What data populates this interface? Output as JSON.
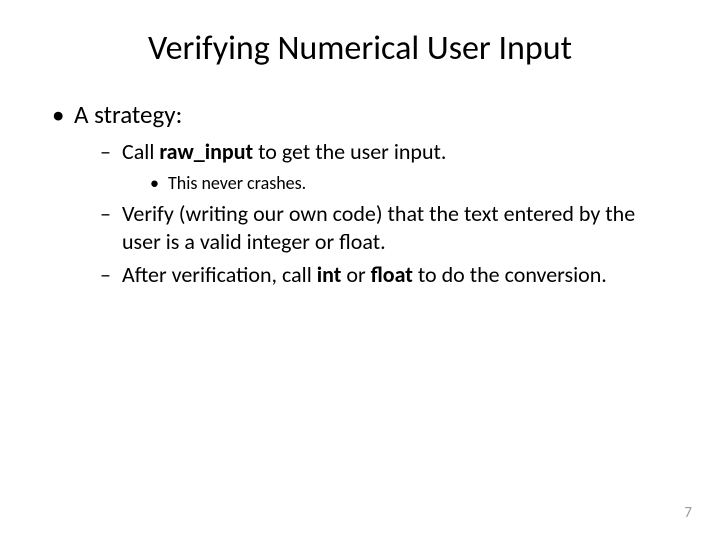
{
  "title": "Verifying Numerical User Input",
  "bullets": {
    "l1": {
      "text": "A strategy:"
    },
    "l2a": {
      "pre": "Call ",
      "bold": "raw_input",
      "post": " to get the user input."
    },
    "l3a": {
      "text": "This never crashes."
    },
    "l2b": {
      "text": "Verify (writing our own code) that the text entered by the user is a valid integer or float."
    },
    "l2c": {
      "pre": "After verification, call ",
      "bold1": "int",
      "mid": " or ",
      "bold2": "float",
      "post": " to do the conversion."
    }
  },
  "page_number": "7"
}
